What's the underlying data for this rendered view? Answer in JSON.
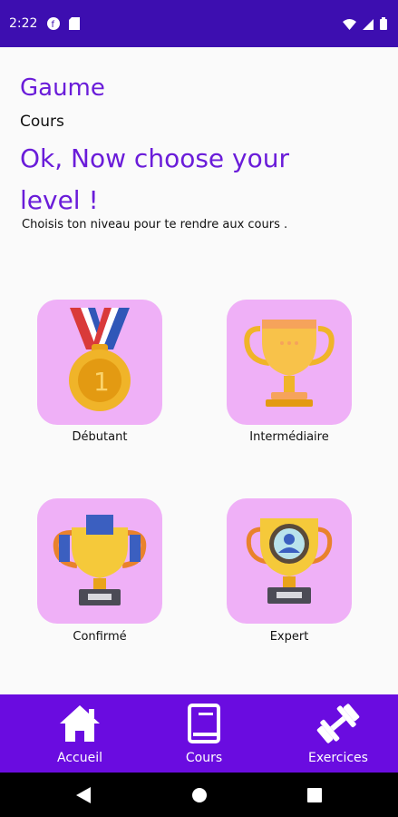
{
  "status_bar": {
    "time": "2:22",
    "icons_left": [
      "circle-f-icon",
      "sd-card-icon"
    ],
    "icons_right": [
      "wifi-icon",
      "cell-signal-icon",
      "battery-icon"
    ]
  },
  "header": {
    "app_title": "Gaume",
    "subtitle": "Cours",
    "headline": "Ok, Now choose your level !",
    "description": "Choisis ton niveau pour te rendre aux cours ."
  },
  "levels": [
    {
      "label": "Débutant",
      "icon": "medal-icon"
    },
    {
      "label": "Intermédiaire",
      "icon": "trophy-icon"
    },
    {
      "label": "Confirmé",
      "icon": "trophy-ribbon-icon"
    },
    {
      "label": "Expert",
      "icon": "trophy-portrait-icon"
    }
  ],
  "bottom_nav": [
    {
      "label": "Accueil",
      "icon": "home-icon"
    },
    {
      "label": "Cours",
      "icon": "book-icon"
    },
    {
      "label": "Exercices",
      "icon": "dumbbell-icon"
    }
  ],
  "colors": {
    "status_bar": "#3d0eb0",
    "accent": "#6a1cd9",
    "card_bg": "#efb0f7",
    "bottom_nav": "#6a0ce0",
    "system_nav": "#000000"
  }
}
